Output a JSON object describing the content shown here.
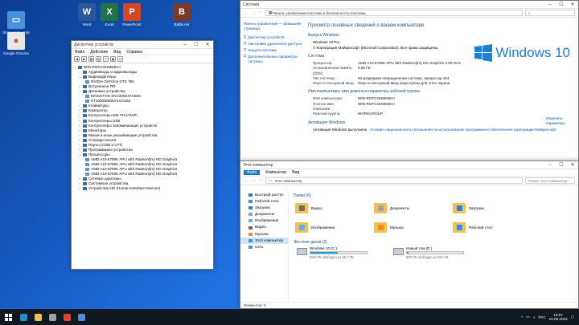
{
  "desktop": {
    "icons": [
      {
        "label": "Word",
        "color": "#2b579a",
        "glyph": "W"
      },
      {
        "label": "Excel",
        "color": "#217346",
        "glyph": "X"
      },
      {
        "label": "PowerPoint",
        "color": "#d24726",
        "glyph": "P"
      },
      {
        "label": "Battle.net",
        "color": "#7a3a2a",
        "glyph": "B"
      },
      {
        "label": "Этот компьютер",
        "color": "#4a90d9",
        "glyph": "▭"
      },
      {
        "label": "Google Chrome",
        "color": "#e8e8e8",
        "glyph": "●"
      }
    ]
  },
  "device_manager": {
    "title": "Диспетчер устройств",
    "menu": [
      "Файл",
      "Действие",
      "Вид",
      "Справка"
    ],
    "root": "WIN-RGFCOHM64KH",
    "tree": [
      {
        "label": "Аудиовходы и аудиовыходы",
        "expanded": false
      },
      {
        "label": "Видеоадаптеры",
        "expanded": true,
        "children": [
          "NVIDIA GeForce GTX 760"
        ]
      },
      {
        "label": "Встроенное ПО",
        "expanded": false
      },
      {
        "label": "Дисковые устройства",
        "expanded": true,
        "children": [
          "KINGSTON SKC300S37A60G",
          "ST1000DM003-1CH162"
        ]
      },
      {
        "label": "Клавиатуры",
        "expanded": false
      },
      {
        "label": "Компьютер",
        "expanded": false
      },
      {
        "label": "Контроллеры IDE ATA/ATAPI",
        "expanded": false
      },
      {
        "label": "Контроллеры USB",
        "expanded": false
      },
      {
        "label": "Контроллеры запоминающих устройств",
        "expanded": false
      },
      {
        "label": "Мониторы",
        "expanded": false
      },
      {
        "label": "Мыши и иные указывающие устройства",
        "expanded": false
      },
      {
        "label": "Очереди печати",
        "expanded": false
      },
      {
        "label": "Порты (COM и LPT)",
        "expanded": false
      },
      {
        "label": "Программные устройства",
        "expanded": false
      },
      {
        "label": "Процессоры",
        "expanded": true,
        "children": [
          "AMD A10-6790K APU with Radeon(tm) HD Graphics",
          "AMD A10-6790K APU with Radeon(tm) HD Graphics",
          "AMD A10-6790K APU with Radeon(tm) HD Graphics",
          "AMD A10-6790K APU with Radeon(tm) HD Graphics"
        ]
      },
      {
        "label": "Сетевые адаптеры",
        "expanded": false
      },
      {
        "label": "Системные устройства",
        "expanded": false
      },
      {
        "label": "Устройства HID (Human Interface Devices)",
        "expanded": false
      }
    ]
  },
  "system": {
    "title": "Система",
    "breadcrumb": [
      "Панель управления",
      "Система и безопасность",
      "Система"
    ],
    "sidebar": {
      "home": "Панель управления — домашняя страница",
      "links": [
        "Диспетчер устройств",
        "Настройка удаленного доступа",
        "Защита системы",
        "Дополнительные параметры системы"
      ]
    },
    "heading": "Просмотр основных сведений о вашем компьютере",
    "edition": {
      "header": "Выпуск Windows",
      "name": "Windows 10 Pro",
      "copyright": "© Корпорация Майкрософт (Microsoft Corporation). Все права защищены."
    },
    "logo_text": "Windows 10",
    "sys": {
      "header": "Система",
      "rows": [
        {
          "k": "Процессор:",
          "v": "AMD A10-6790K APU with Radeon(tm) HD Graphics    4.00 GHz"
        },
        {
          "k": "Установленная память (ОЗУ):",
          "v": "8,00 ГБ"
        },
        {
          "k": "Тип системы:",
          "v": "64-разрядная операционная система, процессор x64"
        },
        {
          "k": "Перо и сенсорный ввод:",
          "v": "Перо и сенсорный ввод недоступны для этого экрана"
        }
      ]
    },
    "name": {
      "header": "Имя компьютера, имя домена и параметры рабочей группы",
      "rows": [
        {
          "k": "Имя компьютера:",
          "v": "WIN-RGFCOHM64KH"
        },
        {
          "k": "Полное имя:",
          "v": "WIN-RGFCOHM64KH"
        },
        {
          "k": "Описание:",
          "v": ""
        },
        {
          "k": "Рабочая группа:",
          "v": "WORKGROUP"
        }
      ],
      "change": "Изменить параметры"
    },
    "activation": {
      "header": "Активация Windows",
      "status": "Активация Windows выполнена",
      "link": "Условия лицензионного соглашения на использование программного обеспечения корпорации Майкрософт"
    }
  },
  "explorer": {
    "title": "Этот компьютер",
    "tabs": [
      "Файл",
      "Компьютер",
      "Вид"
    ],
    "address": "Этот компьютер",
    "search_placeholder": "Поиск: Этот компьютер",
    "nav": [
      {
        "label": "Быстрый доступ",
        "color": "#2f7de1"
      },
      {
        "label": "Рабочий стол",
        "color": "#3b8be8"
      },
      {
        "label": "Загрузки",
        "color": "#2f7de1"
      },
      {
        "label": "Документы",
        "color": "#9aa4b1"
      },
      {
        "label": "Изображения",
        "color": "#5fb0f0"
      },
      {
        "label": "Видео",
        "color": "#6b6b6b"
      },
      {
        "label": "Музыка",
        "color": "#f08a24"
      },
      {
        "label": "Этот компьютер",
        "color": "#4a90d9",
        "selected": true
      },
      {
        "label": "Сеть",
        "color": "#4a90d9"
      }
    ],
    "folders_header": "Папки (6)",
    "folders": [
      {
        "label": "Видео",
        "color": "#6b6b6b"
      },
      {
        "label": "Документы",
        "color": "#9aa4b1"
      },
      {
        "label": "Загрузки",
        "color": "#2f7de1"
      },
      {
        "label": "Изображения",
        "color": "#5fb0f0"
      },
      {
        "label": "Музыка",
        "color": "#f08a24"
      },
      {
        "label": "Рабочий стол",
        "color": "#3b8be8"
      }
    ],
    "drives_header": "Жесткие диски (2)",
    "drives": [
      {
        "label": "Windows 10 (C:)",
        "free": "28,5 ГБ свободно из 55,7 ГБ",
        "used_fraction": 0.49
      },
      {
        "label": "Новый том (D:)",
        "free": "900 ГБ свободно из 931 ГБ",
        "used_fraction": 0.03
      }
    ],
    "status": "Элементов: 8"
  },
  "taskbar": {
    "apps": [
      {
        "name": "edge",
        "color": "#1e90d6"
      },
      {
        "name": "explorer",
        "color": "#f2c14e"
      },
      {
        "name": "settings",
        "color": "#9aa4b1"
      },
      {
        "name": "chrome",
        "color": "#e94235"
      },
      {
        "name": "device-manager",
        "color": "#4a90d9"
      }
    ],
    "lang": "РУС",
    "time": "19:07",
    "date": "16.09.2024"
  },
  "watermark": "Avito"
}
